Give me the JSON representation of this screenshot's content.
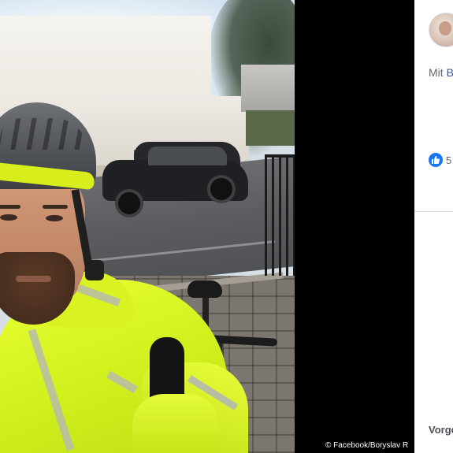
{
  "photo": {
    "credit": "© Facebook/Boryslav R"
  },
  "side_panel": {
    "with_prefix": "Mit",
    "with_name": "B",
    "like_count": "5",
    "footer_label": "Vorge"
  },
  "colors": {
    "facebook_blue": "#1877f2",
    "link_blue": "#385898",
    "panel_bg": "#ffffff",
    "backdrop": "#000000"
  },
  "icons": [
    "like-icon",
    "avatar"
  ]
}
